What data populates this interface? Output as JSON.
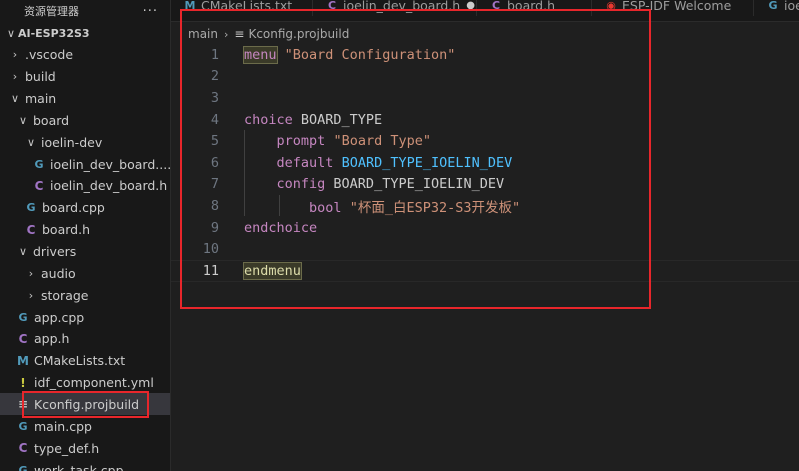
{
  "sidebar": {
    "title": "资源管理器",
    "more": "···",
    "items": [
      {
        "label": "AI-ESP32S3",
        "chevron": "∨",
        "icon": "",
        "indent": 0,
        "root": true
      },
      {
        "label": ".vscode",
        "chevron": "›",
        "icon": "",
        "indent": 1
      },
      {
        "label": "build",
        "chevron": "›",
        "icon": "",
        "indent": 1
      },
      {
        "label": "main",
        "chevron": "∨",
        "icon": "",
        "indent": 1
      },
      {
        "label": "board",
        "chevron": "∨",
        "icon": "",
        "indent": 2
      },
      {
        "label": "ioelin-dev",
        "chevron": "∨",
        "icon": "",
        "indent": 3
      },
      {
        "label": "ioelin_dev_board....",
        "chevron": "",
        "icon": "cpp",
        "indent": 4
      },
      {
        "label": "ioelin_dev_board.h",
        "chevron": "",
        "icon": "c",
        "indent": 4
      },
      {
        "label": "board.cpp",
        "chevron": "",
        "icon": "cpp",
        "indent": 3
      },
      {
        "label": "board.h",
        "chevron": "",
        "icon": "c",
        "indent": 3
      },
      {
        "label": "drivers",
        "chevron": "∨",
        "icon": "",
        "indent": 2
      },
      {
        "label": "audio",
        "chevron": "›",
        "icon": "",
        "indent": 3
      },
      {
        "label": "storage",
        "chevron": "›",
        "icon": "",
        "indent": 3
      },
      {
        "label": "app.cpp",
        "chevron": "",
        "icon": "cpp",
        "indent": 2
      },
      {
        "label": "app.h",
        "chevron": "",
        "icon": "c",
        "indent": 2
      },
      {
        "label": "CMakeLists.txt",
        "chevron": "",
        "icon": "m",
        "indent": 2
      },
      {
        "label": "idf_component.yml",
        "chevron": "",
        "icon": "bang",
        "indent": 2
      },
      {
        "label": "Kconfig.projbuild",
        "chevron": "",
        "icon": "lines",
        "indent": 2,
        "selected": true
      },
      {
        "label": "main.cpp",
        "chevron": "",
        "icon": "cpp",
        "indent": 2
      },
      {
        "label": "type_def.h",
        "chevron": "",
        "icon": "c",
        "indent": 2
      },
      {
        "label": "work_task.cpp",
        "chevron": "",
        "icon": "cpp",
        "indent": 2
      }
    ]
  },
  "tabs": [
    {
      "label": "CMakeLists.txt",
      "icon": "m",
      "dirty": false
    },
    {
      "label": "ioelin_dev_board.h",
      "icon": "c",
      "dirty": true
    },
    {
      "label": "board.h",
      "icon": "c",
      "dirty": false
    },
    {
      "label": "ESP-IDF Welcome",
      "icon": "esp",
      "dirty": false
    },
    {
      "label": "ioe",
      "icon": "cpp",
      "dirty": false
    }
  ],
  "icons": {
    "cpp": "G",
    "c": "C",
    "m": "M",
    "bang": "!",
    "lines": "≡",
    "esp": "◉"
  },
  "breadcrumb": {
    "folder": "main",
    "separator": "›",
    "file": "Kconfig.projbuild",
    "file_icon": "≡"
  },
  "editor": {
    "current_line": 11,
    "lines": [
      {
        "n": "1",
        "tokens": [
          {
            "t": "menu",
            "c": "kw"
          },
          {
            "t": " ",
            "c": "plain"
          },
          {
            "t": "\"Board Configuration\"",
            "c": "str"
          }
        ]
      },
      {
        "n": "2",
        "tokens": []
      },
      {
        "n": "3",
        "tokens": []
      },
      {
        "n": "4",
        "tokens": [
          {
            "t": "choice",
            "c": "kw"
          },
          {
            "t": " BOARD_TYPE",
            "c": "plain"
          }
        ]
      },
      {
        "n": "5",
        "tokens": [
          {
            "t": "    ",
            "c": "plain"
          },
          {
            "t": "prompt",
            "c": "kw"
          },
          {
            "t": " ",
            "c": "plain"
          },
          {
            "t": "\"Board Type\"",
            "c": "str"
          }
        ]
      },
      {
        "n": "6",
        "tokens": [
          {
            "t": "    ",
            "c": "plain"
          },
          {
            "t": "default",
            "c": "kw"
          },
          {
            "t": " ",
            "c": "plain"
          },
          {
            "t": "BOARD_TYPE_IOELIN_DEV",
            "c": "const"
          }
        ]
      },
      {
        "n": "7",
        "tokens": [
          {
            "t": "    ",
            "c": "plain"
          },
          {
            "t": "config",
            "c": "kw"
          },
          {
            "t": " BOARD_TYPE_IOELIN_DEV",
            "c": "plain"
          }
        ]
      },
      {
        "n": "8",
        "tokens": [
          {
            "t": "        ",
            "c": "plain"
          },
          {
            "t": "bool",
            "c": "kw"
          },
          {
            "t": " ",
            "c": "plain"
          },
          {
            "t": "\"杯面_白ESP32-S3开发板\"",
            "c": "str"
          }
        ]
      },
      {
        "n": "9",
        "tokens": [
          {
            "t": "endchoice",
            "c": "kw"
          }
        ]
      },
      {
        "n": "10",
        "tokens": []
      },
      {
        "n": "11",
        "tokens": [
          {
            "t": "endmenu",
            "c": "fn"
          }
        ]
      }
    ]
  },
  "colors": {
    "annotation": "#e8262b",
    "selected_row": "#37373d",
    "background": "#1f1f1f"
  }
}
